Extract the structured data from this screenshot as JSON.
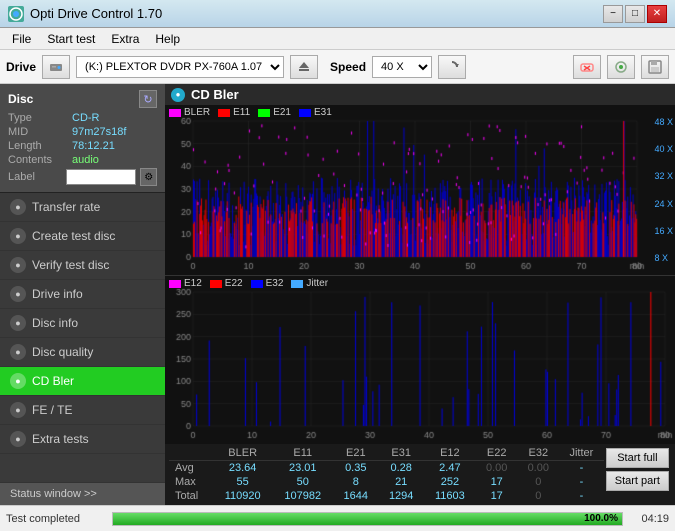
{
  "app": {
    "title": "Opti Drive Control 1.70",
    "icon": "ODC"
  },
  "title_buttons": {
    "minimize": "−",
    "maximize": "□",
    "close": "✕"
  },
  "menu": {
    "items": [
      "File",
      "Start test",
      "Extra",
      "Help"
    ]
  },
  "drive": {
    "label": "Drive",
    "drive_value": "(K:)  PLEXTOR DVDR  PX-760A 1.07",
    "speed_label": "Speed",
    "speed_value": "40 X"
  },
  "disc": {
    "header": "Disc",
    "type_label": "Type",
    "type_value": "CD-R",
    "mid_label": "MID",
    "mid_value": "97m27s18f",
    "length_label": "Length",
    "length_value": "78:12.21",
    "contents_label": "Contents",
    "contents_value": "audio",
    "label_label": "Label"
  },
  "nav": {
    "items": [
      {
        "id": "transfer-rate",
        "label": "Transfer rate",
        "active": false
      },
      {
        "id": "create-test-disc",
        "label": "Create test disc",
        "active": false
      },
      {
        "id": "verify-test-disc",
        "label": "Verify test disc",
        "active": false
      },
      {
        "id": "drive-info",
        "label": "Drive info",
        "active": false
      },
      {
        "id": "disc-info",
        "label": "Disc info",
        "active": false
      },
      {
        "id": "disc-quality",
        "label": "Disc quality",
        "active": false
      },
      {
        "id": "cd-bler",
        "label": "CD Bler",
        "active": true
      },
      {
        "id": "fe-te",
        "label": "FE / TE",
        "active": false
      },
      {
        "id": "extra-tests",
        "label": "Extra tests",
        "active": false
      }
    ],
    "status_window": "Status window >>"
  },
  "chart": {
    "title": "CD Bler",
    "top_legend": [
      "BLER",
      "E11",
      "E21",
      "E31"
    ],
    "top_legend_colors": [
      "#ff00ff",
      "#ff0000",
      "#00ff00",
      "#0000ff"
    ],
    "bottom_legend": [
      "E12",
      "E22",
      "E32",
      "Jitter"
    ],
    "bottom_legend_colors": [
      "#ff00ff",
      "#ff0000",
      "#0000ff",
      "#00aaff"
    ],
    "top_ymax": 60,
    "top_right_labels": [
      "48 X",
      "40 X",
      "32 X",
      "24 X",
      "16 X",
      "8 X"
    ],
    "xmax": 80,
    "bottom_ymax": 300
  },
  "stats": {
    "columns": [
      "",
      "BLER",
      "E11",
      "E21",
      "E31",
      "E12",
      "E22",
      "E32",
      "Jitter"
    ],
    "rows": [
      {
        "label": "Avg",
        "values": [
          "23.64",
          "23.01",
          "0.35",
          "0.28",
          "2.47",
          "0.00",
          "0.00",
          "-"
        ]
      },
      {
        "label": "Max",
        "values": [
          "55",
          "50",
          "8",
          "21",
          "252",
          "17",
          "0",
          "-"
        ]
      },
      {
        "label": "Total",
        "values": [
          "110920",
          "107982",
          "1644",
          "1294",
          "11603",
          "17",
          "0",
          "-"
        ]
      }
    ],
    "buttons": [
      "Start full",
      "Start part"
    ]
  },
  "status_bar": {
    "text": "Test completed",
    "progress": 100.0,
    "progress_text": "100.0%",
    "time": "04:19"
  }
}
